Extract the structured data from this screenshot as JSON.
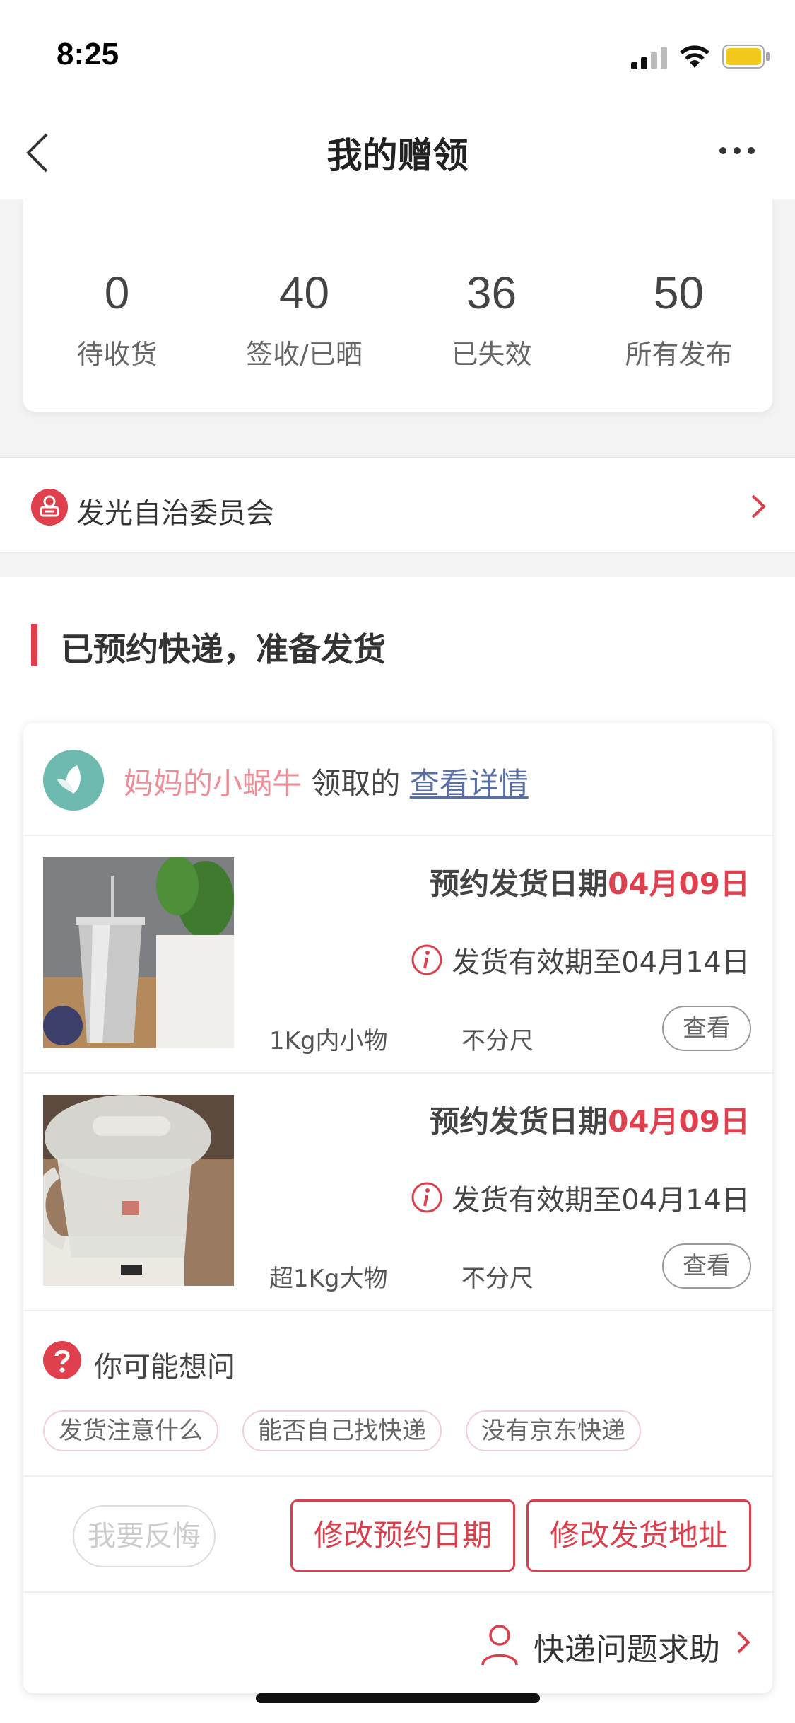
{
  "status_bar": {
    "time": "8:25"
  },
  "nav": {
    "title": "我的赠领"
  },
  "stats": [
    {
      "value": "0",
      "label": "待收货"
    },
    {
      "value": "40",
      "label": "签收/已晒"
    },
    {
      "value": "36",
      "label": "已失效"
    },
    {
      "value": "50",
      "label": "所有发布"
    }
  ],
  "org": {
    "name": "发光自治委员会"
  },
  "section": {
    "title": "已预约快递，准备发货"
  },
  "order": {
    "receiver": "妈妈的小蜗牛",
    "received_label": " 领取的 ",
    "detail_link": "查看详情",
    "items": [
      {
        "ship_label": "预约发货日期",
        "ship_date": "04月09日",
        "validity": "发货有效期至04月14日",
        "weight": "1Kg内小物",
        "size": "不分尺",
        "view_label": "查看"
      },
      {
        "ship_label": "预约发货日期",
        "ship_date": "04月09日",
        "validity": "发货有效期至04月14日",
        "weight": "超1Kg大物",
        "size": "不分尺",
        "view_label": "查看"
      }
    ],
    "faq": {
      "title": "你可能想问",
      "tags": [
        "发货注意什么",
        "能否自己找快递",
        "没有京东快递"
      ]
    },
    "actions": {
      "regret": "我要反悔",
      "change_date": "修改预约日期",
      "change_address": "修改发货地址"
    },
    "help": {
      "label": "快递问题求助"
    }
  },
  "colors": {
    "accent": "#e0404e",
    "link": "#5a6fa6",
    "avatar": "#6fbab0"
  }
}
